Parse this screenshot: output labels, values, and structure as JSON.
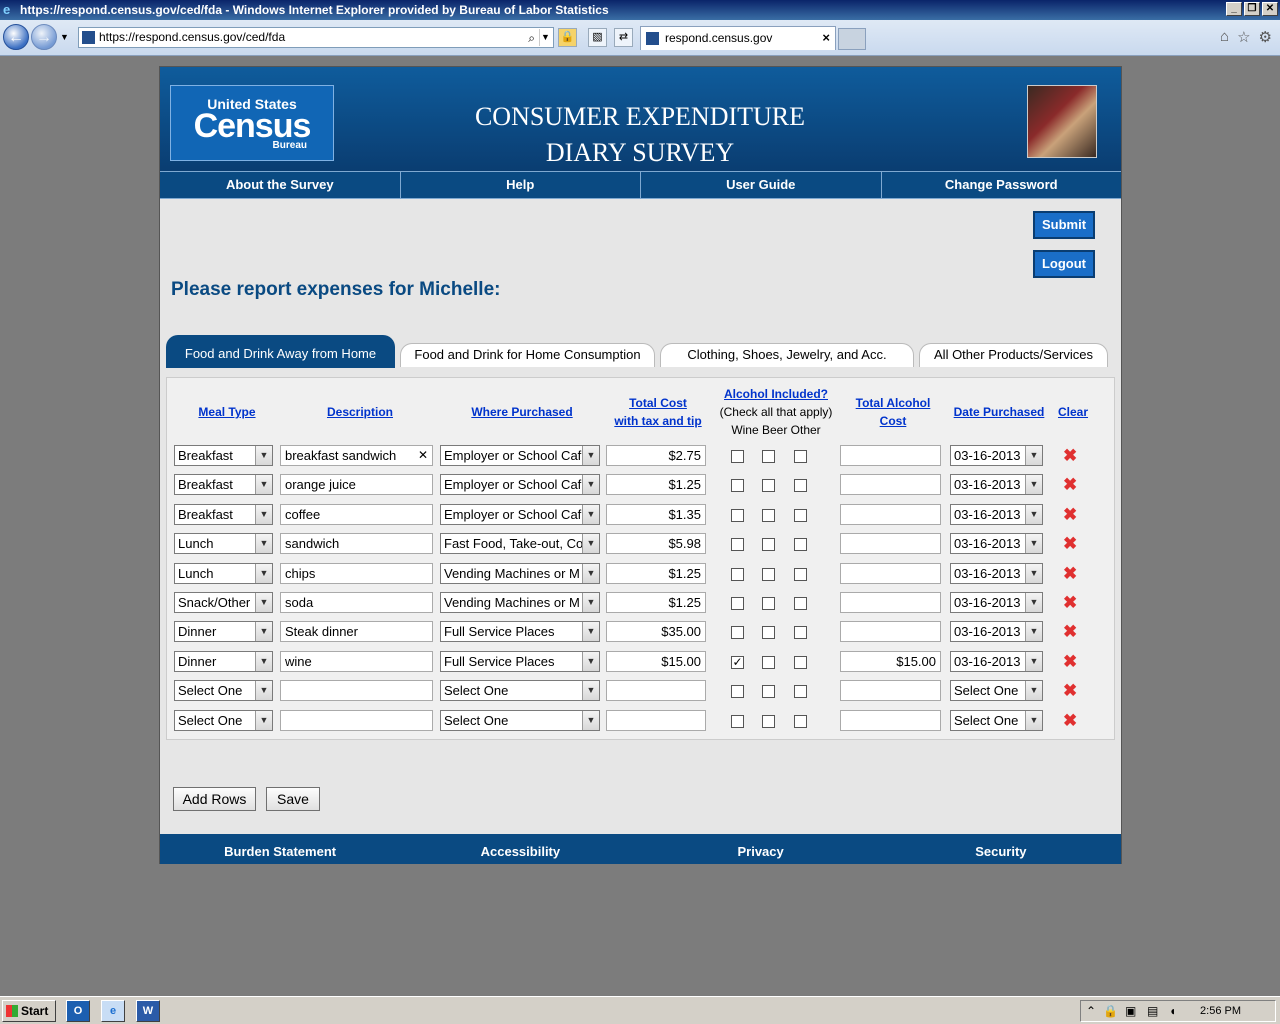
{
  "window": {
    "title": "https://respond.census.gov/ced/fda - Windows Internet Explorer provided by Bureau of Labor Statistics"
  },
  "browser": {
    "address": "https://respond.census.gov/ced/fda",
    "tab_label": "respond.census.gov"
  },
  "header": {
    "logo_top": "United States",
    "logo_main": "Census",
    "logo_bottom": "Bureau",
    "title_line1": "CONSUMER EXPENDITURE",
    "title_line2": "DIARY SURVEY"
  },
  "nav": [
    "About the Survey",
    "Help",
    "User Guide",
    "Change Password"
  ],
  "actions": {
    "submit": "Submit",
    "logout": "Logout"
  },
  "prompt": "Please report expenses for Michelle:",
  "tabs": [
    "Food and Drink Away from Home",
    "Food and Drink for Home Consumption",
    "Clothing, Shoes, Jewelry, and Acc.",
    "All Other Products/Services"
  ],
  "columns": {
    "meal_type": "Meal Type",
    "description": "Description",
    "where": "Where Purchased",
    "cost1": "Total Cost",
    "cost2": "with tax and tip",
    "alcohol": "Alcohol Included?",
    "alcohol_note": "(Check all that apply)",
    "alcohol_sub": "Wine Beer Other",
    "alc_cost1": "Total Alcohol",
    "alc_cost2": "Cost",
    "date": "Date Purchased",
    "clear": "Clear"
  },
  "rows": [
    {
      "meal": "Breakfast",
      "desc": "breakfast sandwich",
      "where": "Employer or School Caf",
      "cost": "$2.75",
      "wine": false,
      "beer": false,
      "other": false,
      "alc_cost": "",
      "date": "03-16-2013"
    },
    {
      "meal": "Breakfast",
      "desc": "orange juice",
      "where": "Employer or School Caf",
      "cost": "$1.25",
      "wine": false,
      "beer": false,
      "other": false,
      "alc_cost": "",
      "date": "03-16-2013"
    },
    {
      "meal": "Breakfast",
      "desc": "coffee",
      "where": "Employer or School Caf",
      "cost": "$1.35",
      "wine": false,
      "beer": false,
      "other": false,
      "alc_cost": "",
      "date": "03-16-2013"
    },
    {
      "meal": "Lunch",
      "desc": "sandwich",
      "where": "Fast Food, Take-out, Co",
      "cost": "$5.98",
      "wine": false,
      "beer": false,
      "other": false,
      "alc_cost": "",
      "date": "03-16-2013"
    },
    {
      "meal": "Lunch",
      "desc": "chips",
      "where": "Vending Machines or M",
      "cost": "$1.25",
      "wine": false,
      "beer": false,
      "other": false,
      "alc_cost": "",
      "date": "03-16-2013"
    },
    {
      "meal": "Snack/Other",
      "desc": "soda",
      "where": "Vending Machines or M",
      "cost": "$1.25",
      "wine": false,
      "beer": false,
      "other": false,
      "alc_cost": "",
      "date": "03-16-2013"
    },
    {
      "meal": "Dinner",
      "desc": "Steak dinner",
      "where": "Full Service Places",
      "cost": "$35.00",
      "wine": false,
      "beer": false,
      "other": false,
      "alc_cost": "",
      "date": "03-16-2013"
    },
    {
      "meal": "Dinner",
      "desc": "wine",
      "where": "Full Service Places",
      "cost": "$15.00",
      "wine": true,
      "beer": false,
      "other": false,
      "alc_cost": "$15.00",
      "date": "03-16-2013"
    },
    {
      "meal": "Select One",
      "desc": "",
      "where": "Select One",
      "cost": "",
      "wine": false,
      "beer": false,
      "other": false,
      "alc_cost": "",
      "date": "Select One"
    },
    {
      "meal": "Select One",
      "desc": "",
      "where": "Select One",
      "cost": "",
      "wine": false,
      "beer": false,
      "other": false,
      "alc_cost": "",
      "date": "Select One"
    }
  ],
  "bottom_buttons": {
    "add_rows": "Add Rows",
    "save": "Save"
  },
  "footer": [
    "Burden Statement",
    "Accessibility",
    "Privacy",
    "Security"
  ],
  "taskbar": {
    "start": "Start",
    "time": "2:56 PM"
  },
  "colors": {
    "accent": "#0a4a82",
    "link": "#0033cc",
    "delete": "#e03030"
  }
}
